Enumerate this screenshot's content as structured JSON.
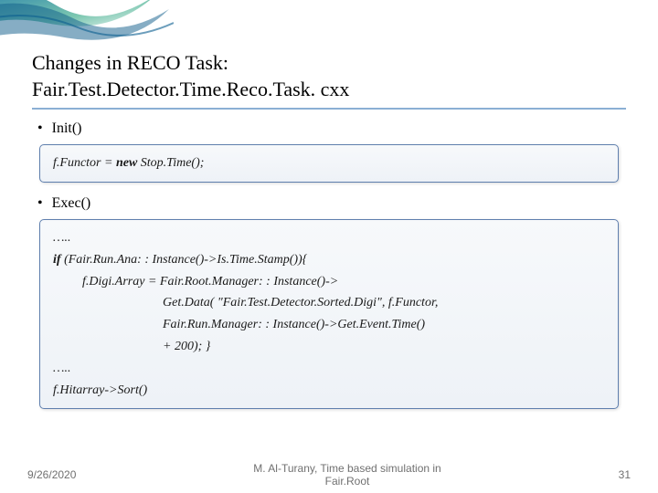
{
  "title_line1": "Changes in RECO Task:",
  "title_line2": "Fair.Test.Detector.Time.Reco.Task. cxx",
  "bullets": {
    "init": "Init()",
    "exec": "Exec()"
  },
  "box_init": "f.Functor = new Stop.Time();",
  "box_exec": {
    "dots1": "…..",
    "if_line": "if (Fair.Run.Ana: : Instance()->Is.Time.Stamp()){",
    "l1": "f.Digi.Array = Fair.Root.Manager: : Instance()->",
    "l2": "Get.Data( \"Fair.Test.Detector.Sorted.Digi\", f.Functor,",
    "l3": "Fair.Run.Manager: : Instance()->Get.Event.Time()",
    "l4": "+ 200); }",
    "dots2": "…..",
    "sort": "f.Hitarray->Sort()"
  },
  "footer": {
    "date": "9/26/2020",
    "center_line1": "M. Al-Turany, Time based simulation in",
    "center_line2": "Fair.Root",
    "page": "31"
  }
}
